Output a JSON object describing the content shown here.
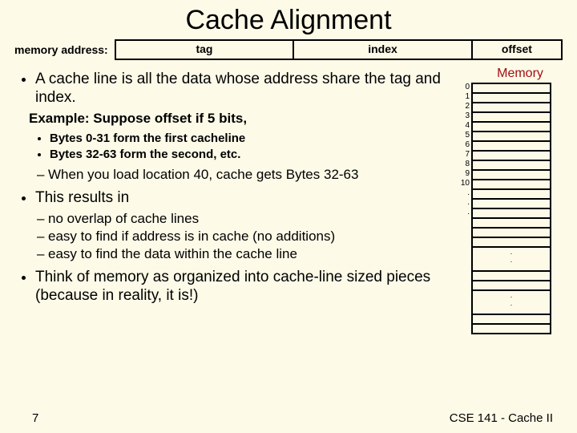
{
  "title": "Cache Alignment",
  "address_row": {
    "label": "memory address:",
    "fields": {
      "tag": "tag",
      "index": "index",
      "offset": "offset"
    }
  },
  "bullets": {
    "b1": "A cache line is all the data whose address share the tag and index.",
    "example": "Example: Suppose offset if 5 bits,",
    "ex_sub1": "Bytes 0-31 form the first cacheline",
    "ex_sub2": "Bytes 32-63 form the second, etc.",
    "b1_dash": "When you load location 40, cache gets Bytes 32-63",
    "b2": "This results in",
    "b2_d1": "no overlap of cache lines",
    "b2_d2": "easy to find if address is in cache (no additions)",
    "b2_d3": "easy to find the data within the cache line",
    "b3": "Think of memory as organized into cache-line sized pieces (because in reality, it is!)"
  },
  "memory": {
    "label": "Memory",
    "rows": [
      "0",
      "1",
      "2",
      "3",
      "4",
      "5",
      "6",
      "7",
      "8",
      "9",
      "10"
    ]
  },
  "footer": {
    "page": "7",
    "course": "CSE 141 - Cache II"
  }
}
